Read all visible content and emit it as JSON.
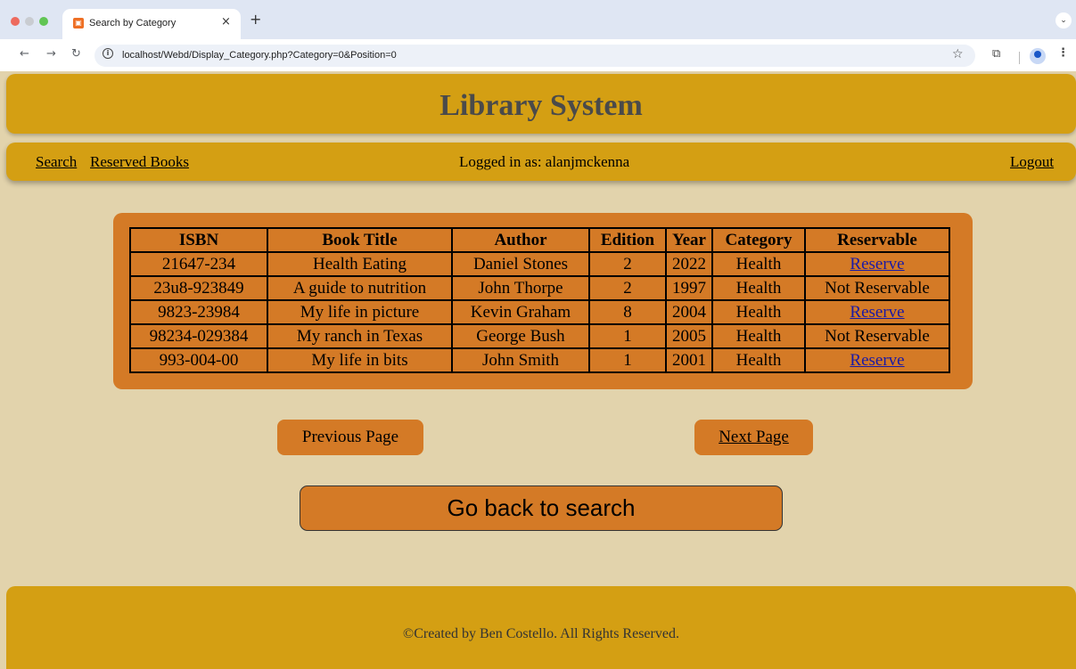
{
  "browser": {
    "tab_title": "Search by Category",
    "tab_close": "×",
    "new_tab": "+",
    "url": "localhost/Webd/Display_Category.php?Category=0&Position=0",
    "colors": {
      "close": "#ed6a5e",
      "minimize": "#c9ccd1",
      "maximize": "#61c554"
    }
  },
  "header": {
    "title": "Library System"
  },
  "nav": {
    "search": "Search",
    "reserved_books": "Reserved Books",
    "logged_in": "Logged in as: alanjmckenna",
    "logout": "Logout"
  },
  "table": {
    "headers": [
      "ISBN",
      "Book Title",
      "Author",
      "Edition",
      "Year",
      "Category",
      "Reservable"
    ],
    "rows": [
      {
        "isbn": "21647-234",
        "title": "Health Eating",
        "author": "Daniel Stones",
        "edition": "2",
        "year": "2022",
        "category": "Health",
        "reservable": "Reserve",
        "link": true
      },
      {
        "isbn": "23u8-923849",
        "title": "A guide to nutrition",
        "author": "John Thorpe",
        "edition": "2",
        "year": "1997",
        "category": "Health",
        "reservable": "Not Reservable",
        "link": false
      },
      {
        "isbn": "9823-23984",
        "title": "My life in picture",
        "author": "Kevin Graham",
        "edition": "8",
        "year": "2004",
        "category": "Health",
        "reservable": "Reserve",
        "link": true
      },
      {
        "isbn": "98234-029384",
        "title": "My ranch in Texas",
        "author": "George Bush",
        "edition": "1",
        "year": "2005",
        "category": "Health",
        "reservable": "Not Reservable",
        "link": false
      },
      {
        "isbn": "993-004-00",
        "title": "My life in bits",
        "author": "John Smith",
        "edition": "1",
        "year": "2001",
        "category": "Health",
        "reservable": "Reserve",
        "link": true
      }
    ]
  },
  "pagination": {
    "previous": "Previous Page",
    "next": "Next Page"
  },
  "back_button": "Go back to search",
  "footer": {
    "text": "©Created by Ben Costello. All Rights Reserved."
  },
  "colors": {
    "page_bg": "#e2d3ac",
    "gold": "#d49f13",
    "orange": "#d47a26",
    "link": "#1a1aa6"
  }
}
